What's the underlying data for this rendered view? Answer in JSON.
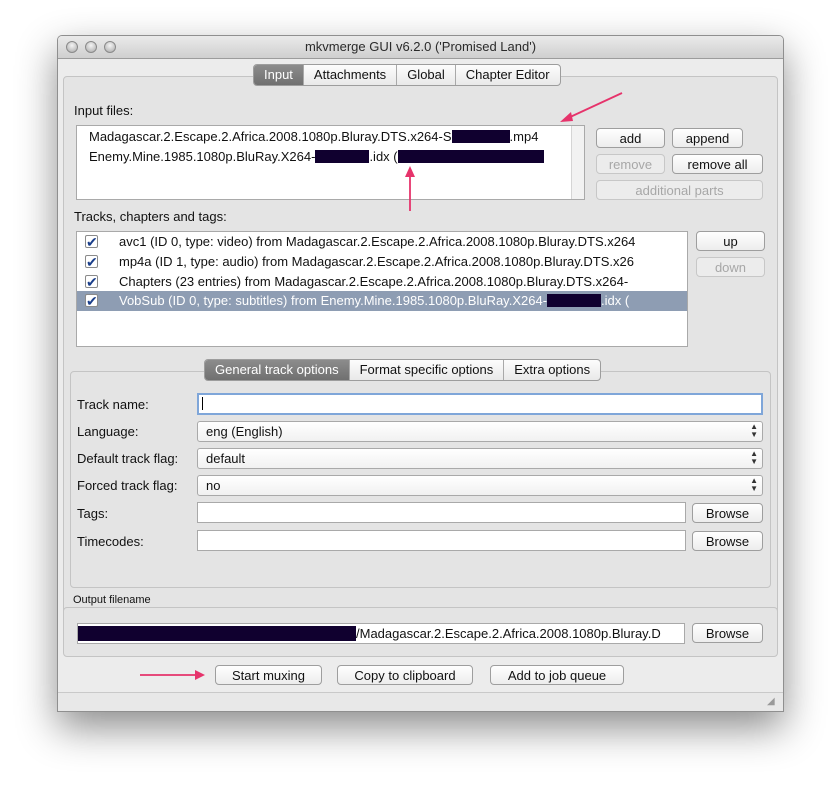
{
  "window": {
    "title": "mkvmerge GUI v6.2.0 ('Promised Land')"
  },
  "main_tabs": [
    "Input",
    "Attachments",
    "Global",
    "Chapter Editor"
  ],
  "input": {
    "input_files_label": "Input files:",
    "files": [
      {
        "before": "Madagascar.2.Escape.2.Africa.2008.1080p.Bluray.DTS.x264-S",
        "after": ".mp4"
      },
      {
        "before": "Enemy.Mine.1985.1080p.BluRay.X264-",
        "after": ".idx ("
      }
    ],
    "buttons": {
      "add": "add",
      "append": "append",
      "remove": "remove",
      "remove_all": "remove all",
      "additional_parts": "additional parts"
    },
    "tracks_label": "Tracks, chapters and tags:",
    "tracks": [
      {
        "before": "avc1 (ID 0, type: video) from Madagascar.2.Escape.2.Africa.2008.1080p.Bluray.DTS.x264",
        "after": ""
      },
      {
        "before": "mp4a (ID 1, type: audio) from Madagascar.2.Escape.2.Africa.2008.1080p.Bluray.DTS.x26",
        "after": ""
      },
      {
        "before": "Chapters (23 entries) from Madagascar.2.Escape.2.Africa.2008.1080p.Bluray.DTS.x264-",
        "after": ""
      },
      {
        "before": "VobSub (ID 0, type: subtitles) from Enemy.Mine.1985.1080p.BluRay.X264-",
        "after": ".idx ("
      }
    ],
    "up": "up",
    "down": "down"
  },
  "track_tabs": [
    "General track options",
    "Format specific options",
    "Extra options"
  ],
  "track_options": {
    "track_name_label": "Track name:",
    "track_name_value": "",
    "language_label": "Language:",
    "language_value": "eng (English)",
    "default_flag_label": "Default track flag:",
    "default_flag_value": "default",
    "forced_flag_label": "Forced track flag:",
    "forced_flag_value": "no",
    "tags_label": "Tags:",
    "timecodes_label": "Timecodes:",
    "browse": "Browse"
  },
  "output": {
    "label": "Output filename",
    "value": "/Madagascar.2.Escape.2.Africa.2008.1080p.Bluray.D",
    "browse": "Browse"
  },
  "actions": {
    "start": "Start muxing",
    "copy": "Copy to clipboard",
    "queue": "Add to job queue"
  },
  "colors": {
    "redaction": "#10002f",
    "annotation_arrow": "#e6336b",
    "selection": "#8e9db3"
  }
}
